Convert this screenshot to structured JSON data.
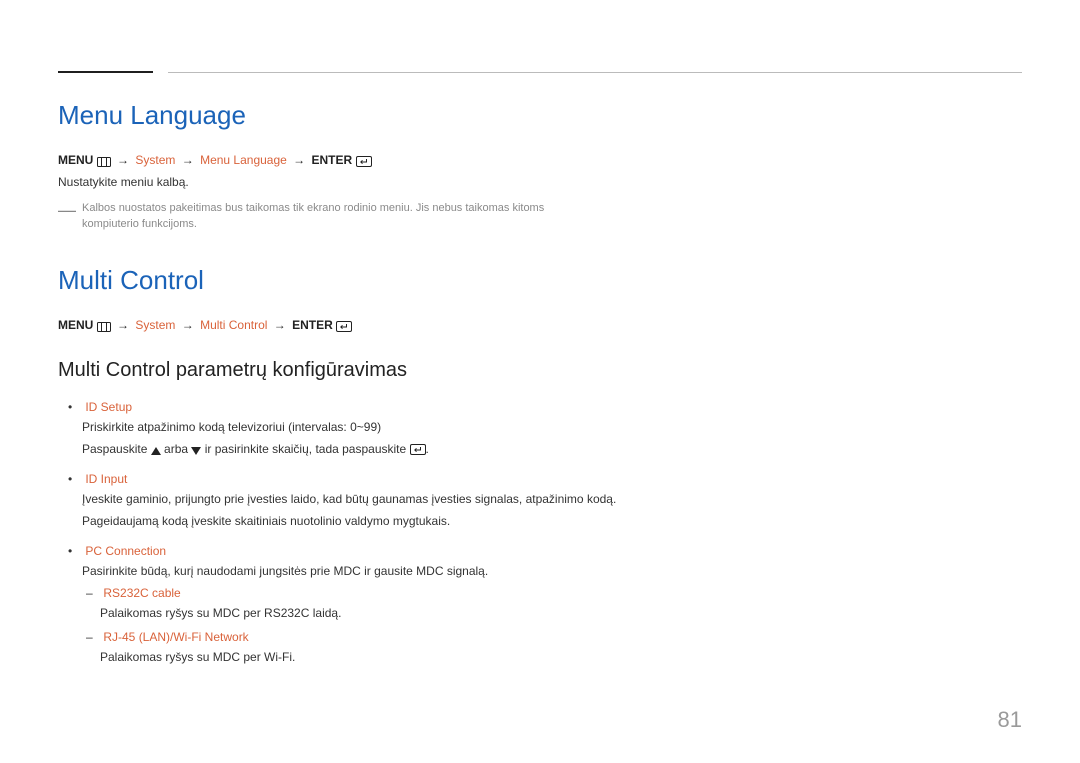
{
  "page_number": "81",
  "section1": {
    "heading": "Menu Language",
    "breadcrumb": {
      "menu": "MENU",
      "system": "System",
      "item": "Menu Language",
      "enter": "ENTER"
    },
    "body": "Nustatykite meniu kalbą.",
    "note": "Kalbos nuostatos pakeitimas bus taikomas tik ekrano rodinio meniu. Jis nebus taikomas kitoms kompiuterio funkcijoms."
  },
  "section2": {
    "heading": "Multi Control",
    "breadcrumb": {
      "menu": "MENU",
      "system": "System",
      "item": "Multi Control",
      "enter": "ENTER"
    },
    "subheading": "Multi Control parametrų konfigūravimas",
    "items": [
      {
        "title": "ID Setup",
        "line1": "Priskirkite atpažinimo kodą televizoriui (intervalas: 0~99)",
        "line2_pre": "Paspauskite ",
        "line2_mid": " arba ",
        "line2_post1": " ir pasirinkite skaičių, tada paspauskite ",
        "line2_post2": "."
      },
      {
        "title": "ID Input",
        "line1": "Įveskite gaminio, prijungto prie įvesties laido, kad būtų gaunamas įvesties signalas, atpažinimo kodą.",
        "line2": "Pageidaujamą kodą įveskite skaitiniais nuotolinio valdymo mygtukais."
      },
      {
        "title": "PC Connection",
        "line1": "Pasirinkite būdą, kurį naudodami jungsitės prie MDC ir gausite MDC signalą.",
        "sub": [
          {
            "title": "RS232C cable",
            "line": "Palaikomas ryšys su MDC per RS232C laidą."
          },
          {
            "title": "RJ-45 (LAN)/Wi-Fi Network",
            "line": "Palaikomas ryšys su MDC per Wi-Fi."
          }
        ]
      }
    ]
  }
}
